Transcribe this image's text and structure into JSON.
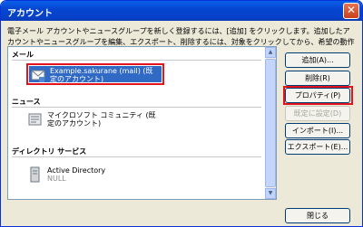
{
  "window": {
    "title": "アカウント",
    "close_symbol": "✕"
  },
  "description": "電子メール アカウントやニュースグループを新しく登録するには、[追加] をクリックします。追加したアカウントやニュースグループを編集、エクスポート、削除するには、対象をクリックしてから、希望の動作をクリックします。",
  "groups": {
    "mail": {
      "header": "メール",
      "account_label": "Example.sakurane (mail) (既定のアカウント)"
    },
    "news": {
      "header": "ニュース",
      "account_label": "マイクロソフト コミュニティ (既定のアカウント)"
    },
    "directory": {
      "header": "ディレクトリ サービス",
      "account_label": "Active Directory",
      "account_sub": "NULL"
    }
  },
  "buttons": {
    "add": "追加(A)...",
    "remove": "削除(R)",
    "properties": "プロパティ(P)",
    "set_default": "既定に設定(D)",
    "import": "インポート(I)...",
    "export": "エクスポート(E)...",
    "close": "閉じる"
  },
  "colors": {
    "highlight": "#e3141b",
    "selection": "#316ac5",
    "titlebar": "#0646d1"
  }
}
